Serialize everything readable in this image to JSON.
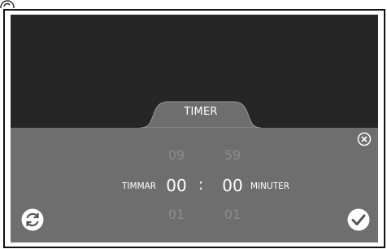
{
  "tab": {
    "label": "TIMER"
  },
  "hours": {
    "label": "TIMMAR",
    "prev": "09",
    "current": "00",
    "next": "01"
  },
  "separator": ":",
  "minutes": {
    "label": "MINUTER",
    "prev": "59",
    "current": "00",
    "next": "01"
  },
  "icons": {
    "top_left": "refresh-icon",
    "close": "close-icon",
    "reset": "refresh-icon",
    "confirm": "check-icon"
  },
  "colors": {
    "background": "#262626",
    "panel": "#6e6e6e",
    "accent": "#ffffff",
    "dim_digits": "#8c8c8c"
  }
}
